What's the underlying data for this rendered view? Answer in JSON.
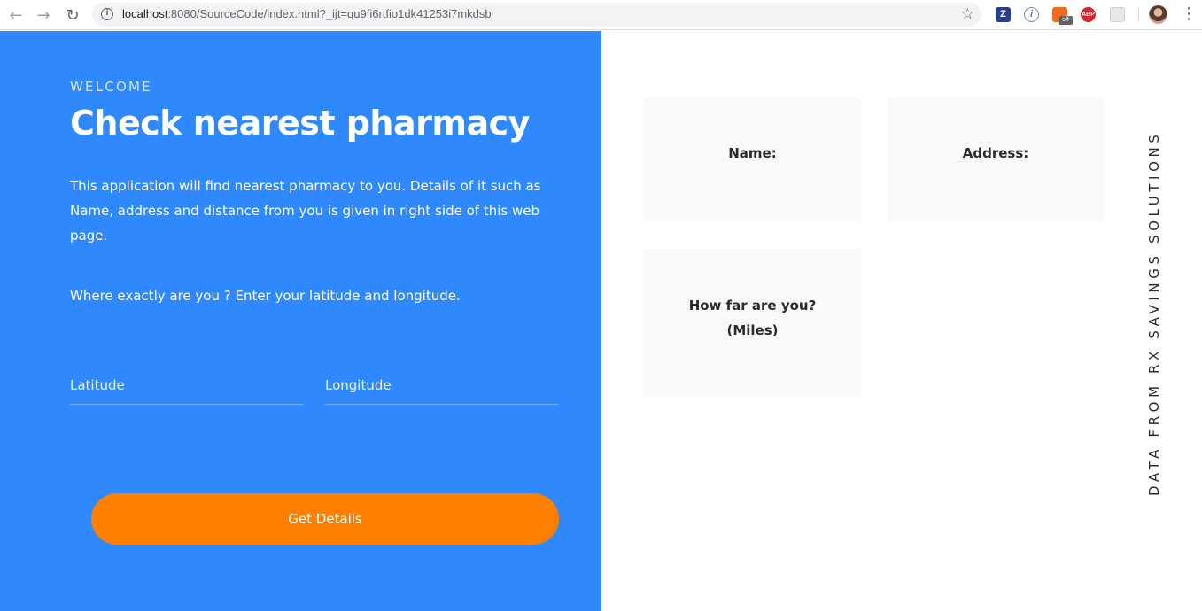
{
  "browser": {
    "url_host": "localhost",
    "url_rest": ":8080/SourceCode/index.html?_ijt=qu9fi6rtfio1dk41253i7mkdsb",
    "back_icon": "arrow-left-icon",
    "forward_icon": "arrow-right-icon",
    "reload_icon": "reload-icon",
    "extensions": [
      {
        "name": "zotero-extension-icon",
        "glyph": "Z"
      },
      {
        "name": "info-extension-icon",
        "glyph": "i"
      },
      {
        "name": "off-extension-icon",
        "glyph": "",
        "badge": "off"
      },
      {
        "name": "adblock-extension-icon",
        "glyph": "ABP"
      },
      {
        "name": "gray-extension-icon",
        "glyph": ""
      }
    ]
  },
  "hero": {
    "eyebrow": "WELCOME",
    "title": "Check nearest pharmacy",
    "description": "This application will find nearest pharmacy to you. Details of it such as Name, address and distance from you is given in right side of this web page.",
    "prompt": "Where exactly are you ? Enter your latitude and longitude."
  },
  "form": {
    "latitude_placeholder": "Latitude",
    "longitude_placeholder": "Longitude",
    "submit_label": "Get Details"
  },
  "results": {
    "name_label": "Name:",
    "address_label": "Address:",
    "distance_label_line1": "How far are you?",
    "distance_label_line2": "(Miles)"
  },
  "sidebar": {
    "vertical_caption": "DATA FROM RX SAVINGS SOLUTIONS"
  },
  "colors": {
    "panel_blue": "#2f88fc",
    "button_orange": "#ff8000",
    "card_bg": "#f9f9f9"
  }
}
